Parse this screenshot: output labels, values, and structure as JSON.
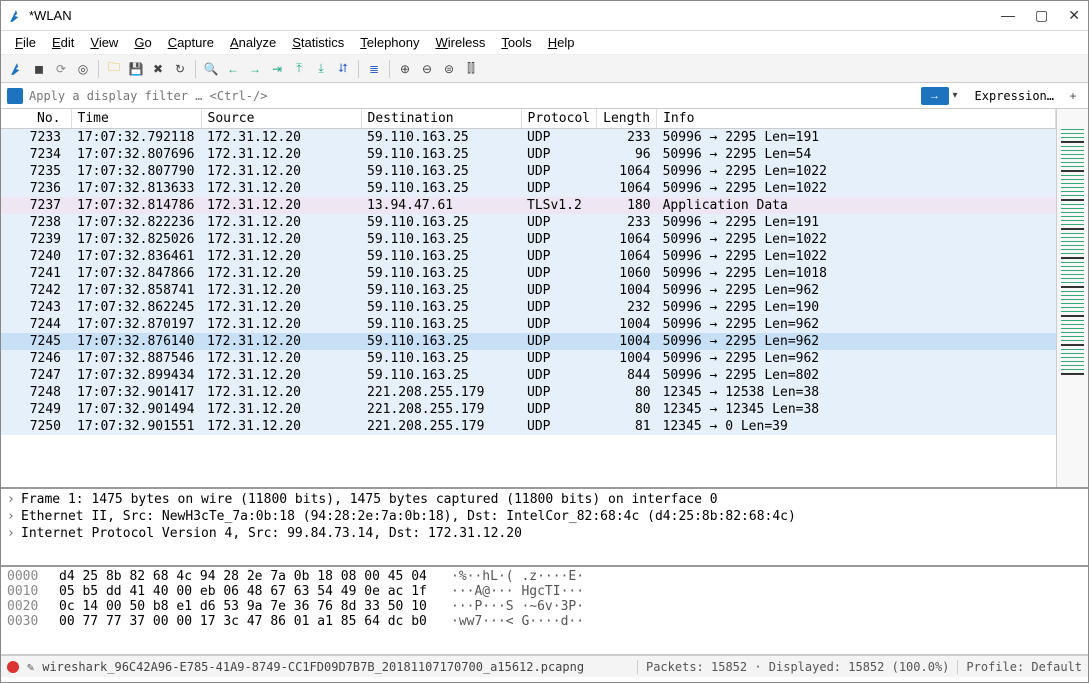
{
  "title": "*WLAN",
  "menu": [
    "File",
    "Edit",
    "View",
    "Go",
    "Capture",
    "Analyze",
    "Statistics",
    "Telephony",
    "Wireless",
    "Tools",
    "Help"
  ],
  "filter_placeholder": "Apply a display filter … <Ctrl-/>",
  "expression_label": "Expression…",
  "columns": [
    "No.",
    "Time",
    "Source",
    "Destination",
    "Protocol",
    "Length",
    "Info"
  ],
  "packets": [
    {
      "no": 7233,
      "time": "17:07:32.792118",
      "src": "172.31.12.20",
      "dst": "59.110.163.25",
      "proto": "UDP",
      "len": 233,
      "info": "50996 → 2295 Len=191"
    },
    {
      "no": 7234,
      "time": "17:07:32.807696",
      "src": "172.31.12.20",
      "dst": "59.110.163.25",
      "proto": "UDP",
      "len": 96,
      "info": "50996 → 2295 Len=54"
    },
    {
      "no": 7235,
      "time": "17:07:32.807790",
      "src": "172.31.12.20",
      "dst": "59.110.163.25",
      "proto": "UDP",
      "len": 1064,
      "info": "50996 → 2295 Len=1022"
    },
    {
      "no": 7236,
      "time": "17:07:32.813633",
      "src": "172.31.12.20",
      "dst": "59.110.163.25",
      "proto": "UDP",
      "len": 1064,
      "info": "50996 → 2295 Len=1022"
    },
    {
      "no": 7237,
      "time": "17:07:32.814786",
      "src": "172.31.12.20",
      "dst": "13.94.47.61",
      "proto": "TLSv1.2",
      "len": 180,
      "info": "Application Data",
      "tls": true
    },
    {
      "no": 7238,
      "time": "17:07:32.822236",
      "src": "172.31.12.20",
      "dst": "59.110.163.25",
      "proto": "UDP",
      "len": 233,
      "info": "50996 → 2295 Len=191"
    },
    {
      "no": 7239,
      "time": "17:07:32.825026",
      "src": "172.31.12.20",
      "dst": "59.110.163.25",
      "proto": "UDP",
      "len": 1064,
      "info": "50996 → 2295 Len=1022"
    },
    {
      "no": 7240,
      "time": "17:07:32.836461",
      "src": "172.31.12.20",
      "dst": "59.110.163.25",
      "proto": "UDP",
      "len": 1064,
      "info": "50996 → 2295 Len=1022"
    },
    {
      "no": 7241,
      "time": "17:07:32.847866",
      "src": "172.31.12.20",
      "dst": "59.110.163.25",
      "proto": "UDP",
      "len": 1060,
      "info": "50996 → 2295 Len=1018"
    },
    {
      "no": 7242,
      "time": "17:07:32.858741",
      "src": "172.31.12.20",
      "dst": "59.110.163.25",
      "proto": "UDP",
      "len": 1004,
      "info": "50996 → 2295 Len=962"
    },
    {
      "no": 7243,
      "time": "17:07:32.862245",
      "src": "172.31.12.20",
      "dst": "59.110.163.25",
      "proto": "UDP",
      "len": 232,
      "info": "50996 → 2295 Len=190"
    },
    {
      "no": 7244,
      "time": "17:07:32.870197",
      "src": "172.31.12.20",
      "dst": "59.110.163.25",
      "proto": "UDP",
      "len": 1004,
      "info": "50996 → 2295 Len=962"
    },
    {
      "no": 7245,
      "time": "17:07:32.876140",
      "src": "172.31.12.20",
      "dst": "59.110.163.25",
      "proto": "UDP",
      "len": 1004,
      "info": "50996 → 2295 Len=962",
      "sel": true
    },
    {
      "no": 7246,
      "time": "17:07:32.887546",
      "src": "172.31.12.20",
      "dst": "59.110.163.25",
      "proto": "UDP",
      "len": 1004,
      "info": "50996 → 2295 Len=962"
    },
    {
      "no": 7247,
      "time": "17:07:32.899434",
      "src": "172.31.12.20",
      "dst": "59.110.163.25",
      "proto": "UDP",
      "len": 844,
      "info": "50996 → 2295 Len=802"
    },
    {
      "no": 7248,
      "time": "17:07:32.901417",
      "src": "172.31.12.20",
      "dst": "221.208.255.179",
      "proto": "UDP",
      "len": 80,
      "info": "12345 → 12538 Len=38"
    },
    {
      "no": 7249,
      "time": "17:07:32.901494",
      "src": "172.31.12.20",
      "dst": "221.208.255.179",
      "proto": "UDP",
      "len": 80,
      "info": "12345 → 12345 Len=38"
    },
    {
      "no": 7250,
      "time": "17:07:32.901551",
      "src": "172.31.12.20",
      "dst": "221.208.255.179",
      "proto": "UDP",
      "len": 81,
      "info": "12345 → 0 Len=39"
    }
  ],
  "details": [
    "Frame 1: 1475 bytes on wire (11800 bits), 1475 bytes captured (11800 bits) on interface 0",
    "Ethernet II, Src: NewH3cTe_7a:0b:18 (94:28:2e:7a:0b:18), Dst: IntelCor_82:68:4c (d4:25:8b:82:68:4c)",
    "Internet Protocol Version 4, Src: 99.84.73.14, Dst: 172.31.12.20"
  ],
  "hex": [
    {
      "off": "0000",
      "b": "d4 25 8b 82 68 4c 94 28  2e 7a 0b 18 08 00 45 04",
      "a": "·%··hL·( .z····E·"
    },
    {
      "off": "0010",
      "b": "05 b5 dd 41 40 00 eb 06  48 67 63 54 49 0e ac 1f",
      "a": "···A@··· HgcTI···"
    },
    {
      "off": "0020",
      "b": "0c 14 00 50 b8 e1 d6 53  9a 7e 36 76 8d 33 50 10",
      "a": "···P···S ·~6v·3P·"
    },
    {
      "off": "0030",
      "b": "00 77 77 37 00 00 17 3c  47 86 01 a1 85 64 dc b0",
      "a": "·ww7···< G····d··"
    }
  ],
  "status": {
    "file": "wireshark_96C42A96-E785-41A9-8749-CC1FD09D7B7B_20181107170700_a15612.pcapng",
    "stats": "Packets: 15852 · Displayed: 15852 (100.0%)",
    "profile": "Profile: Default"
  }
}
